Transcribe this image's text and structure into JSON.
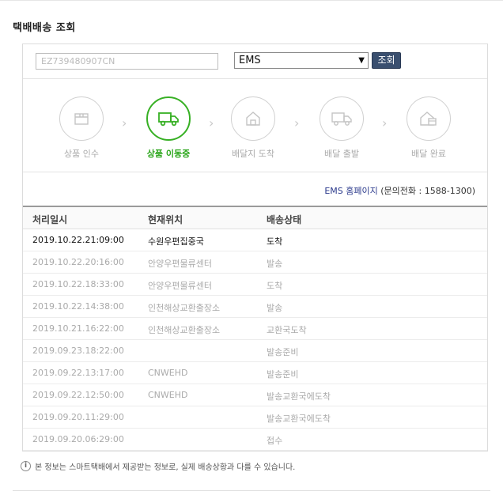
{
  "title": "택배배송 조회",
  "search": {
    "tracking_number": "EZ739480907CN",
    "carrier": "EMS",
    "button_label": "조회"
  },
  "steps": [
    {
      "label": "상품 인수",
      "icon": "box-icon",
      "active": false
    },
    {
      "label": "상품 이동중",
      "icon": "truck-icon",
      "active": true
    },
    {
      "label": "배달지 도착",
      "icon": "house-icon",
      "active": false
    },
    {
      "label": "배달 출발",
      "icon": "delivery-truck-icon",
      "active": false
    },
    {
      "label": "배달 완료",
      "icon": "house-package-icon",
      "active": false
    }
  ],
  "carrier_info": {
    "homepage_link": "EMS 홈페이지",
    "phone": "(문의전화 : 1588-1300)"
  },
  "table": {
    "headers": [
      "처리일시",
      "현재위치",
      "배송상태"
    ],
    "rows": [
      [
        "2019.10.22.21:09:00",
        "수원우편집중국",
        "도착"
      ],
      [
        "2019.10.22.20:16:00",
        "안양우편물류센터",
        "발송"
      ],
      [
        "2019.10.22.18:33:00",
        "안양우편물류센터",
        "도착"
      ],
      [
        "2019.10.22.14:38:00",
        "인천해상교환출장소",
        "발송"
      ],
      [
        "2019.10.21.16:22:00",
        "인천해상교환출장소",
        "교환국도착"
      ],
      [
        "2019.09.23.18:22:00",
        "",
        "발송준비"
      ],
      [
        "2019.09.22.13:17:00",
        "CNWEHD",
        "발송준비"
      ],
      [
        "2019.09.22.12:50:00",
        "CNWEHD",
        "발송교환국에도착"
      ],
      [
        "2019.09.20.11:29:00",
        "",
        "발송교환국에도착"
      ],
      [
        "2019.09.20.06:29:00",
        "",
        "접수"
      ]
    ]
  },
  "note": "본 정보는 스마트택배에서 제공받는 정보로, 실제 배송상황과 다를 수 있습니다.",
  "colors": {
    "active_green": "#37b024",
    "button_navy": "#3a4f6f",
    "link_blue": "#2b3a8c"
  }
}
